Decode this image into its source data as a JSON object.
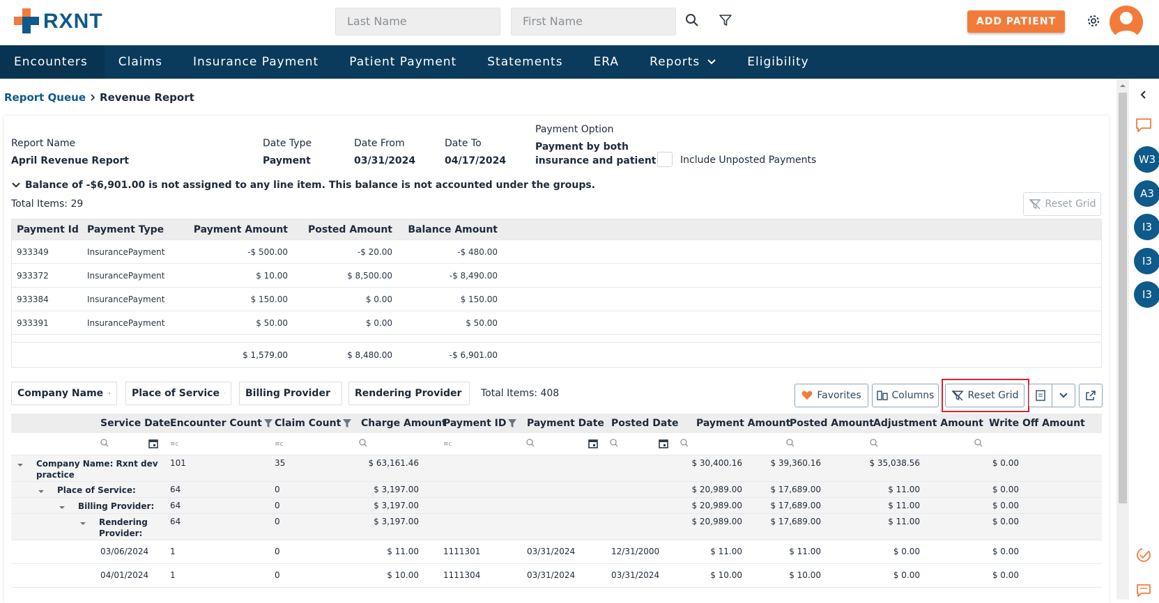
{
  "brand": {
    "name": "RXNT",
    "colors": {
      "brand_blue": "#0e5a8a",
      "accent_orange": "#f37b3a",
      "nav_bg": "#0a3b5c",
      "highlight_red": "#e0202a"
    }
  },
  "search": {
    "last_name_placeholder": "Last Name",
    "first_name_placeholder": "First Name"
  },
  "header": {
    "add_patient": "ADD PATIENT"
  },
  "nav": {
    "items": [
      "Encounters",
      "Claims",
      "Insurance Payment",
      "Patient Payment",
      "Statements",
      "ERA",
      "Reports",
      "Eligibility"
    ]
  },
  "breadcrumb": {
    "parent": "Report Queue",
    "current": "Revenue Report"
  },
  "report": {
    "name_label": "Report Name",
    "name": "April Revenue Report",
    "date_type_label": "Date Type",
    "date_type": "Payment",
    "date_from_label": "Date From",
    "date_from": "03/31/2024",
    "date_to_label": "Date To",
    "date_to": "04/17/2024",
    "payment_option_label": "Payment Option",
    "payment_option_1": "Payment by both",
    "payment_option_2": "insurance and patient",
    "include_unposted": "Include Unposted Payments",
    "balance_msg": "Balance of -$6,901.00 is not assigned to any line item. This balance is not accounted under the groups.",
    "total_items_1": "Total Items: 29",
    "reset_grid": "Reset Grid"
  },
  "payments_table": {
    "headers": [
      "Payment Id",
      "Payment Type",
      "Payment Amount",
      "Posted Amount",
      "Balance Amount"
    ],
    "rows": [
      [
        "933349",
        "InsurancePayment",
        "-$ 500.00",
        "-$ 20.00",
        "-$ 480.00"
      ],
      [
        "933372",
        "InsurancePayment",
        "$ 10.00",
        "$ 8,500.00",
        "-$ 8,490.00"
      ],
      [
        "933384",
        "InsurancePayment",
        "$ 150.00",
        "$ 0.00",
        "$ 150.00"
      ],
      [
        "933391",
        "InsurancePayment",
        "$ 50.00",
        "$ 0.00",
        "$ 50.00"
      ]
    ],
    "totals": [
      "$ 1,579.00",
      "$ 8,480.00",
      "-$ 6,901.00"
    ]
  },
  "group_chips": [
    "Company Name",
    "Place of Service",
    "Billing Provider",
    "Rendering Provider"
  ],
  "total_items_2": "Total Items: 408",
  "grid_buttons": {
    "favorites": "Favorites",
    "columns": "Columns",
    "reset": "Reset Grid"
  },
  "revenue_table": {
    "headers": [
      "Service Date",
      "Encounter Count",
      "Claim Count",
      "Charge Amount",
      "Payment ID",
      "Payment Date",
      "Posted Date",
      "Payment Amount",
      "Posted Amount",
      "Adjustment Amount",
      "Write Off Amount"
    ],
    "groups": [
      {
        "label1": "Company Name: Rxnt dev",
        "label2": "practice",
        "enc": "101",
        "claim": "35",
        "charge": "$ 63,161.46",
        "pay": "$ 30,400.16",
        "posted": "$ 39,360.16",
        "adj": "$ 35,038.56",
        "wo": "$ 0.00"
      },
      {
        "label1": "Place of Service:",
        "label2": "",
        "enc": "64",
        "claim": "0",
        "charge": "$ 3,197.00",
        "pay": "$ 20,989.00",
        "posted": "$ 17,689.00",
        "adj": "$ 11.00",
        "wo": "$ 0.00"
      },
      {
        "label1": "Billing Provider:",
        "label2": "",
        "enc": "64",
        "claim": "0",
        "charge": "$ 3,197.00",
        "pay": "$ 20,989.00",
        "posted": "$ 17,689.00",
        "adj": "$ 11.00",
        "wo": "$ 0.00"
      },
      {
        "label1": "Rendering",
        "label2": "Provider:",
        "enc": "64",
        "claim": "0",
        "charge": "$ 3,197.00",
        "pay": "$ 20,989.00",
        "posted": "$ 17,689.00",
        "adj": "$ 11.00",
        "wo": "$ 0.00"
      }
    ],
    "rows": [
      {
        "svc": "03/06/2024",
        "enc": "1",
        "claim": "0",
        "charge": "$ 11.00",
        "pid": "1111301",
        "pdate": "03/31/2024",
        "posted_date": "12/31/2000",
        "pay": "$ 11.00",
        "posted": "$ 11.00",
        "adj": "$ 0.00",
        "wo": "$ 0.00"
      },
      {
        "svc": "04/01/2024",
        "enc": "1",
        "claim": "0",
        "charge": "$ 10.00",
        "pid": "1111304",
        "pdate": "03/31/2024",
        "posted_date": "03/31/2024",
        "pay": "$ 10.00",
        "posted": "$ 10.00",
        "adj": "$ 0.00",
        "wo": "$ 0.00"
      }
    ]
  },
  "right_rail": [
    "W3",
    "A3",
    "I3",
    "I3",
    "I3"
  ]
}
